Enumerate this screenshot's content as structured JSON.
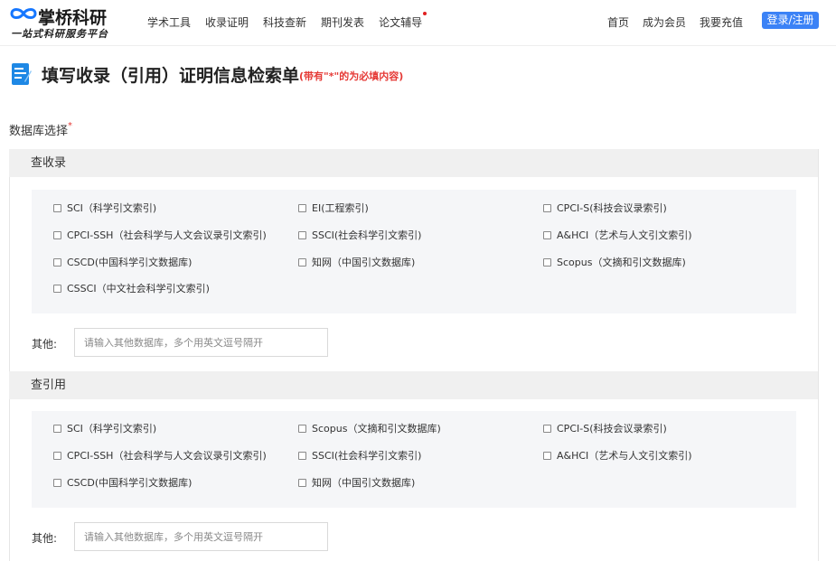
{
  "brand": {
    "name": "掌桥科研",
    "tagline": "一站式科研服务平台",
    "accent": "#3b82f6"
  },
  "nav": {
    "left": [
      {
        "label": "学术工具",
        "badge": false
      },
      {
        "label": "收录证明",
        "badge": false
      },
      {
        "label": "科技查新",
        "badge": false
      },
      {
        "label": "期刊发表",
        "badge": false
      },
      {
        "label": "论文辅导",
        "badge": true
      }
    ],
    "right": [
      "首页",
      "成为会员",
      "我要充值"
    ],
    "login": "登录/注册"
  },
  "page": {
    "title": "填写收录（引用）证明信息检索单",
    "hint": "(带有\"*\"的为必填内容)",
    "db_label": "数据库选择",
    "required_mark": "*"
  },
  "sections": [
    {
      "title": "查收录",
      "options": [
        [
          "SCI（科学引文索引)",
          "EI(工程索引)",
          "CPCI-S(科技会议录索引)"
        ],
        [
          "CPCI-SSH（社会科学与人文会议录引文索引)",
          "SSCI(社会科学引文索引)",
          "A&HCI（艺术与人文引文索引)"
        ],
        [
          "CSCD(中国科学引文数据库)",
          "知网（中国引文数据库)",
          "Scopus（文摘和引文数据库)"
        ],
        [
          "CSSCI（中文社会科学引文索引)"
        ]
      ],
      "other_label": "其他:",
      "other_placeholder": "请输入其他数据库，多个用英文逗号隔开"
    },
    {
      "title": "查引用",
      "options": [
        [
          "SCI（科学引文索引)",
          "Scopus（文摘和引文数据库)",
          "CPCI-S(科技会议录索引)"
        ],
        [
          "CPCI-SSH（社会科学与人文会议录引文索引)",
          "SSCI(社会科学引文索引)",
          "A&HCI（艺术与人文引文索引)"
        ],
        [
          "CSCD(中国科学引文数据库)",
          "知网（中国引文数据库)"
        ]
      ],
      "other_label": "其他:",
      "other_placeholder": "请输入其他数据库，多个用英文逗号隔开"
    }
  ]
}
